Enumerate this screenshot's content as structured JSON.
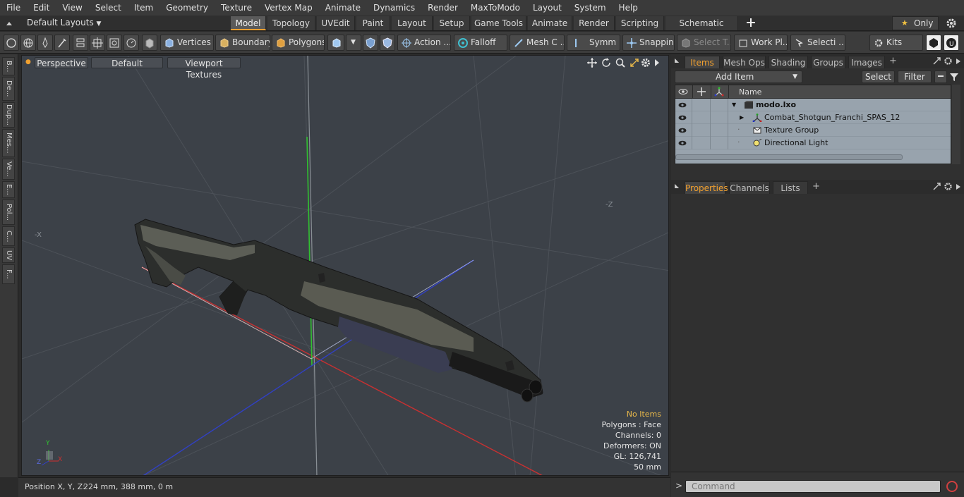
{
  "menu": [
    "File",
    "Edit",
    "View",
    "Select",
    "Item",
    "Geometry",
    "Texture",
    "Vertex Map",
    "Animate",
    "Dynamics",
    "Render",
    "MaxToModo",
    "Layout",
    "System",
    "Help"
  ],
  "layout_bar": {
    "layouts_label": "Default Layouts",
    "tabs": [
      "Model",
      "Topology",
      "UVEdit",
      "Paint",
      "Layout",
      "Setup",
      "Game Tools",
      "Animate",
      "Render",
      "Scripting",
      "Schematic Fusion"
    ],
    "active_tab": "Model",
    "only_label": "Only"
  },
  "toolbar": {
    "vertices": "Vertices",
    "boundary": "Boundary",
    "polygons": "Polygons",
    "action": "Action ...",
    "falloff": "Falloff",
    "mesh": "Mesh C ...",
    "symm": "Symm ...",
    "snapping": "Snapping",
    "select_t": "Select T...",
    "work_pl": "Work Pl...",
    "selecti": "Selecti ...",
    "kits": "Kits"
  },
  "left_tabs": [
    "B...",
    "De...",
    "Dup...",
    "Mes...",
    "Ve...",
    "E...",
    "Pol...",
    "C...",
    "UV",
    "F..."
  ],
  "viewport": {
    "view_label": "Perspective",
    "shading_label": "Default",
    "textures_label": "Viewport Textures",
    "axis_neg_x": "-X",
    "axis_neg_z": "-Z",
    "hud": {
      "selection": "No Items",
      "polygons": "Polygons : Face",
      "channels": "Channels: 0",
      "deformers": "Deformers: ON",
      "gl": "GL: 126,741",
      "scale": "50 mm"
    },
    "gizmo": {
      "x": "X",
      "y": "Y",
      "z": "Z"
    }
  },
  "status": {
    "label": "Position X, Y, Z:",
    "value": "224 mm, 388 mm, 0 m"
  },
  "items_panel": {
    "tabs": [
      "Items",
      "Mesh Ops",
      "Shading",
      "Groups",
      "Images"
    ],
    "active_tab": "Items",
    "add_item": "Add Item",
    "select": "Select",
    "filter": "Filter",
    "column_name": "Name",
    "rows": [
      {
        "name": "modo.lxo",
        "bold": true
      },
      {
        "name": "Combat_Shotgun_Franchi_SPAS_12",
        "bold": false
      },
      {
        "name": "Texture Group",
        "bold": false
      },
      {
        "name": "Directional Light",
        "bold": false
      }
    ]
  },
  "properties_panel": {
    "tabs": [
      "Properties",
      "Channels",
      "Lists"
    ],
    "active_tab": "Properties"
  },
  "command": {
    "prompt": ">",
    "placeholder": "Command"
  },
  "colors": {
    "accent_orange": "#f0a030",
    "axis_x": "#d03030",
    "axis_y": "#30c030",
    "axis_z": "#3040d0"
  }
}
